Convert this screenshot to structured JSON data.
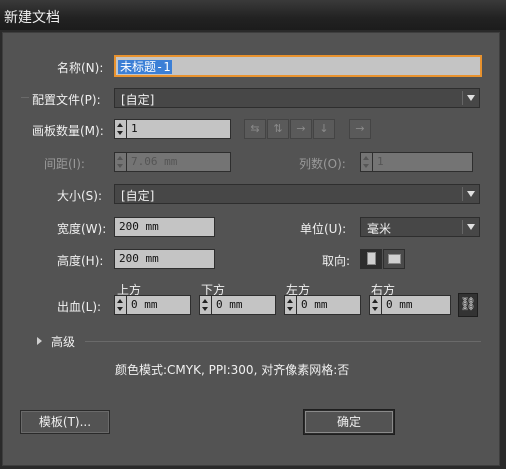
{
  "window": {
    "title": "新建文档"
  },
  "name": {
    "label": "名称(N):",
    "value": "未标题-1"
  },
  "profile": {
    "label": "配置文件(P):",
    "value": "[自定]"
  },
  "artboards": {
    "count_label": "画板数量(M):",
    "count_value": "1",
    "spacing_label": "间距(I):",
    "spacing_value": "7.06 mm",
    "columns_label": "列数(O):",
    "columns_value": "1",
    "layout_icons": [
      "grid-by-row-icon",
      "grid-by-column-icon",
      "arrange-by-row-icon",
      "arrange-by-column-icon",
      "right-to-left-icon"
    ]
  },
  "size": {
    "label": "大小(S):",
    "value": "[自定]"
  },
  "width": {
    "label": "宽度(W):",
    "value": "200 mm"
  },
  "units": {
    "label": "单位(U):",
    "value": "毫米"
  },
  "height": {
    "label": "高度(H):",
    "value": "200 mm"
  },
  "orientation": {
    "label": "取向:",
    "selected": "portrait"
  },
  "bleed": {
    "label": "出血(L):",
    "top_label": "上方",
    "top_value": "0 mm",
    "bottom_label": "下方",
    "bottom_value": "0 mm",
    "left_label": "左方",
    "left_value": "0 mm",
    "right_label": "右方",
    "right_value": "0 mm"
  },
  "advanced": {
    "label": "高级",
    "summary": "颜色模式:CMYK, PPI:300, 对齐像素网格:否"
  },
  "buttons": {
    "templates": "模板(T)...",
    "ok": "确定"
  },
  "colors": {
    "panel": "#535353",
    "focus_border": "#e8922e",
    "selection": "#3b7fd6"
  }
}
